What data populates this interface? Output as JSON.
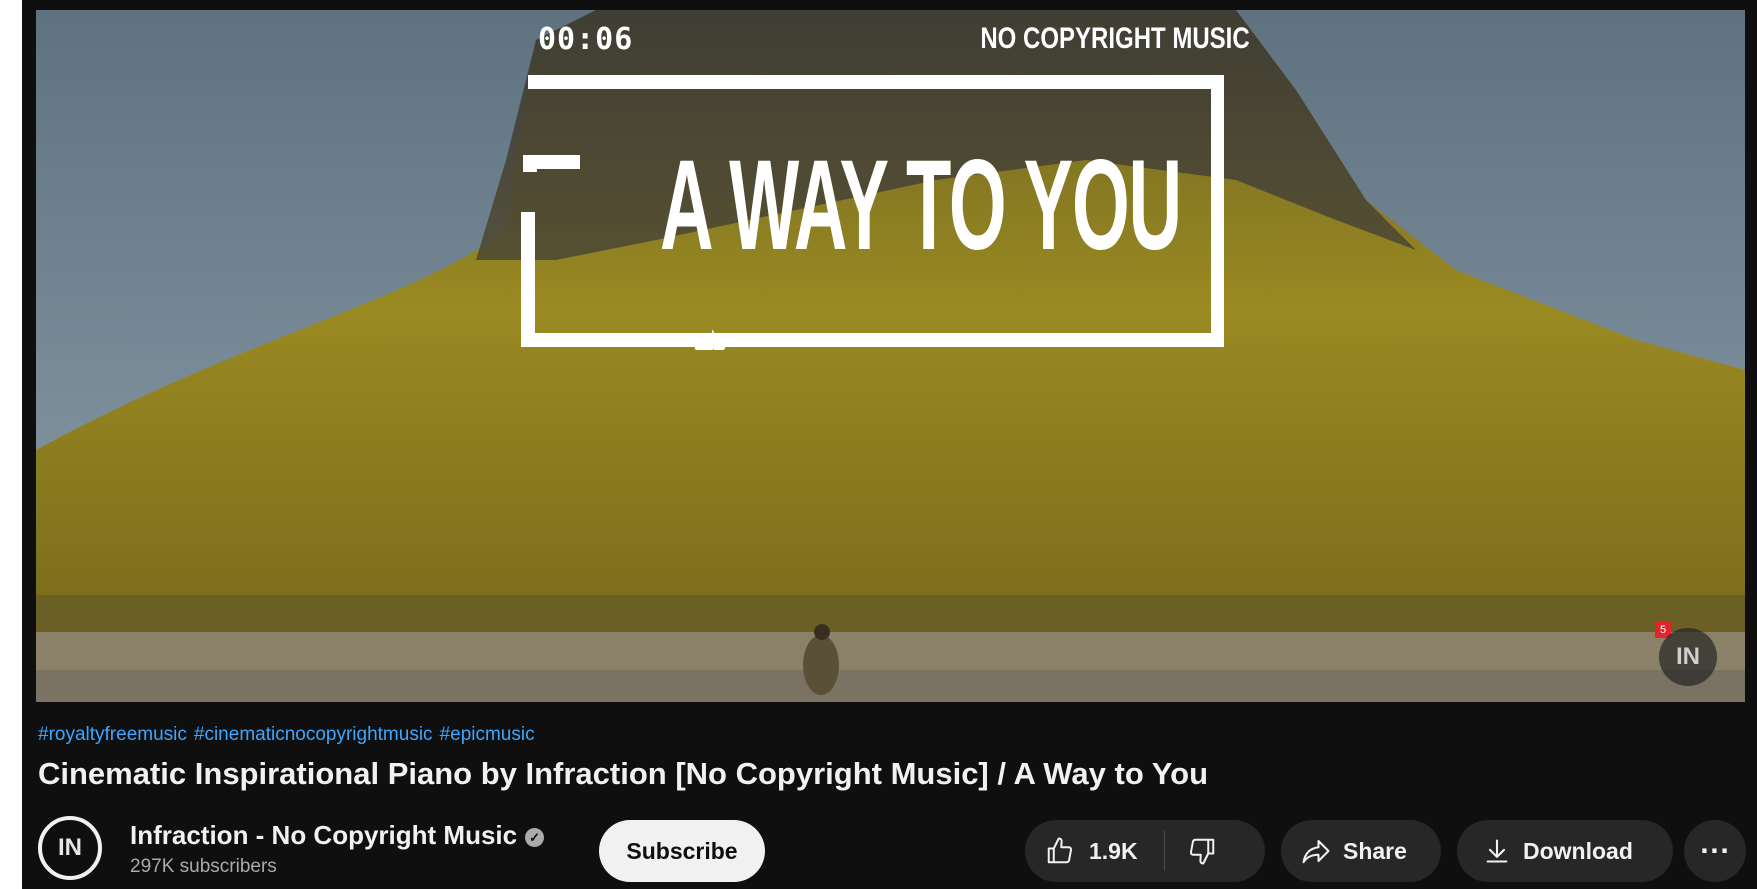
{
  "player": {
    "overlay_time": "00:06",
    "overlay_label": "NO COPYRIGHT MUSIC",
    "overlay_title": "A WAY TO YOU",
    "watermark_text": "IN",
    "watermark_badge": "5"
  },
  "video": {
    "hashtags": [
      "#royaltyfreemusic",
      "#cinematicnocopyrightmusic",
      "#epicmusic"
    ],
    "title": "Cinematic Inspirational Piano by Infraction [No Copyright Music] / A Way to You"
  },
  "channel": {
    "avatar_text": "IN",
    "name": "Infraction - No Copyright Music",
    "subscribers": "297K subscribers",
    "subscribe_label": "Subscribe"
  },
  "actions": {
    "like_count": "1.9K",
    "share_label": "Share",
    "download_label": "Download",
    "more_label": "···"
  },
  "colors": {
    "background": "#0f0f0f",
    "pill": "#272727",
    "hashtag": "#3ea6ff",
    "subscribe_bg": "#f1f1f1"
  }
}
